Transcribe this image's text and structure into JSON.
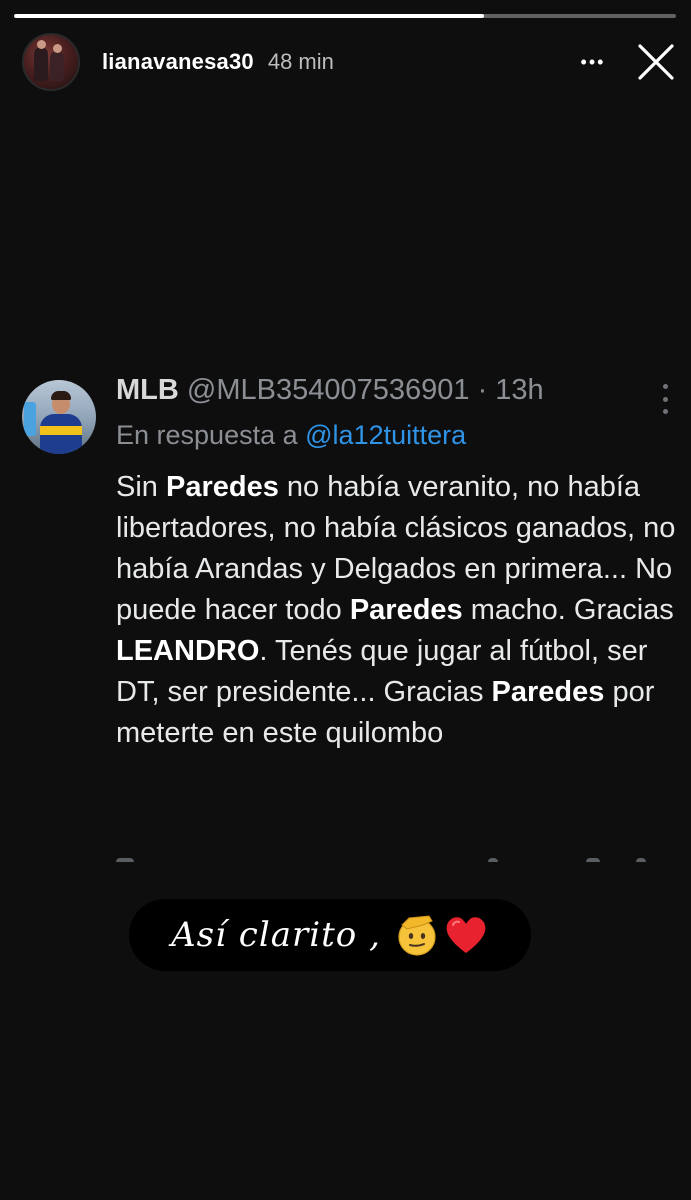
{
  "story": {
    "progress": 0.71,
    "username": "lianavanesa30",
    "time": "48 min",
    "more_label": "•••",
    "close_icon": "close-icon"
  },
  "tweet": {
    "author": "MLB",
    "handle": "@MLB354007536901",
    "separator": "·",
    "time": "13h",
    "reply_prefix": "En respuesta a",
    "reply_mention": "@la12tuittera",
    "body": [
      {
        "text": "Sin ",
        "bold": false
      },
      {
        "text": "Paredes",
        "bold": true
      },
      {
        "text": " no había veranito, no había libertadores, no había clásicos ganados, no había Arandas y Delgados en primera... No puede hacer todo ",
        "bold": false
      },
      {
        "text": "Paredes",
        "bold": true
      },
      {
        "text": " macho. Gracias ",
        "bold": false
      },
      {
        "text": "LEANDRO",
        "bold": true
      },
      {
        "text": ". Tenés que jugar al fútbol, ser DT, ser presidente... Gracias ",
        "bold": false
      },
      {
        "text": "Paredes",
        "bold": true
      },
      {
        "text": " por meterte en este quilombo",
        "bold": false
      }
    ]
  },
  "caption": {
    "text": "Así clarito ,",
    "emoji": [
      "saluting-face-icon",
      "red-heart-icon"
    ]
  },
  "colors": {
    "background": "#0e0e0f",
    "mention": "#2f93e6",
    "muted": "#8b8f94",
    "heart": "#e8222e"
  }
}
